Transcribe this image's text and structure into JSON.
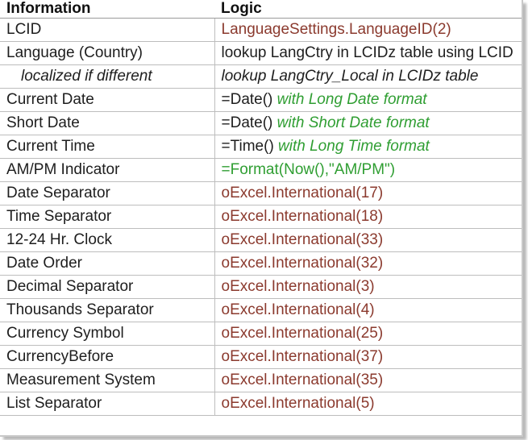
{
  "header": {
    "information": "Information",
    "logic": "Logic"
  },
  "colors": {
    "red_logic": "#8b3a2e",
    "green_logic": "#2f9e32",
    "plain_text": "#1e1e1e",
    "grid_line": "#bdbdbd"
  },
  "rows": [
    {
      "info": "LCID",
      "parts": [
        {
          "text": "LanguageSettings.LanguageID(2)",
          "style": "red"
        }
      ]
    },
    {
      "info": "Language (Country)",
      "parts": [
        {
          "text": "lookup LangCtry in LCIDz table using LCID",
          "style": "plain"
        }
      ]
    },
    {
      "info": "localized if different",
      "parts": [
        {
          "text": "lookup LangCtry_Local in LCIDz table",
          "style": "plain"
        }
      ]
    },
    {
      "info": "Current Date",
      "parts": [
        {
          "text": "=Date() ",
          "style": "plain"
        },
        {
          "text": "with Long Date format",
          "style": "green-it"
        }
      ]
    },
    {
      "info": "Short Date",
      "parts": [
        {
          "text": "=Date() ",
          "style": "plain"
        },
        {
          "text": "with Short Date format",
          "style": "green-it"
        }
      ]
    },
    {
      "info": "Current Time",
      "parts": [
        {
          "text": "=Time() ",
          "style": "plain"
        },
        {
          "text": "with Long Time format",
          "style": "green-it"
        }
      ]
    },
    {
      "info": "AM/PM Indicator",
      "parts": [
        {
          "text": "=Format(Now(),\"AM/PM\")",
          "style": "green"
        }
      ]
    },
    {
      "info": "Date Separator",
      "parts": [
        {
          "text": "oExcel.International(17)",
          "style": "red"
        }
      ]
    },
    {
      "info": "Time Separator",
      "parts": [
        {
          "text": "oExcel.International(18)",
          "style": "red"
        }
      ]
    },
    {
      "info": "12-24 Hr. Clock",
      "parts": [
        {
          "text": "oExcel.International(33)",
          "style": "red"
        }
      ]
    },
    {
      "info": "Date Order",
      "parts": [
        {
          "text": "oExcel.International(32)",
          "style": "red"
        }
      ]
    },
    {
      "info": "Decimal Separator",
      "parts": [
        {
          "text": "oExcel.International(3)",
          "style": "red"
        }
      ]
    },
    {
      "info": "Thousands Separator",
      "parts": [
        {
          "text": "oExcel.International(4)",
          "style": "red"
        }
      ]
    },
    {
      "info": "Currency Symbol",
      "parts": [
        {
          "text": "oExcel.International(25)",
          "style": "red"
        }
      ]
    },
    {
      "info": "CurrencyBefore",
      "parts": [
        {
          "text": "oExcel.International(37)",
          "style": "red"
        }
      ]
    },
    {
      "info": "Measurement System",
      "parts": [
        {
          "text": "oExcel.International(35)",
          "style": "red"
        }
      ]
    },
    {
      "info": "List Separator",
      "parts": [
        {
          "text": "oExcel.International(5)",
          "style": "red"
        }
      ]
    }
  ]
}
